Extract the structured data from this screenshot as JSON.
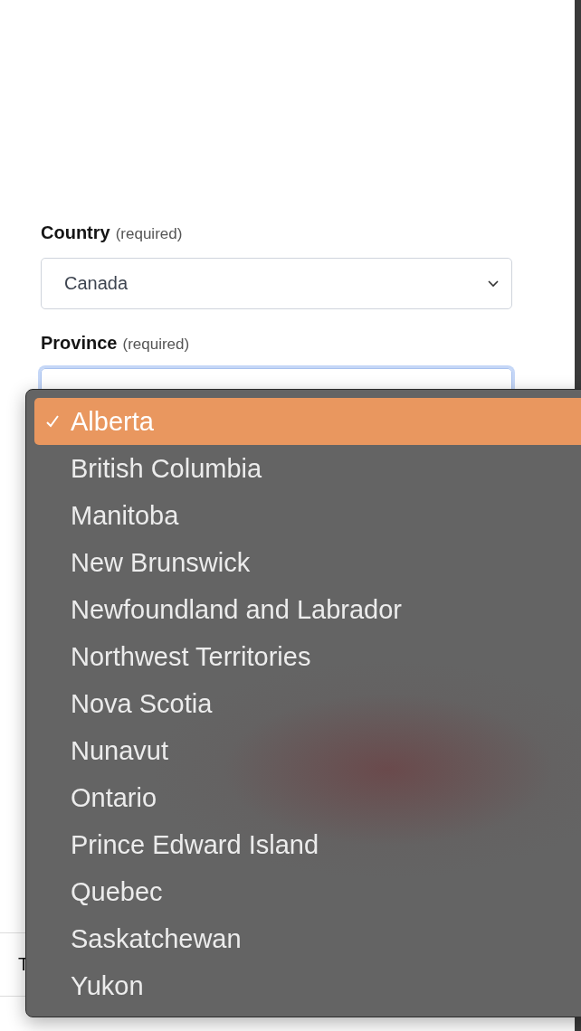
{
  "country": {
    "label": "Country",
    "hint": "(required)",
    "value": "Canada"
  },
  "province": {
    "label": "Province",
    "hint": "(required)",
    "focused": true
  },
  "dropdown": {
    "options": [
      {
        "label": "Alberta",
        "selected": true
      },
      {
        "label": "British Columbia",
        "selected": false
      },
      {
        "label": "Manitoba",
        "selected": false
      },
      {
        "label": "New Brunswick",
        "selected": false
      },
      {
        "label": "Newfoundland and Labrador",
        "selected": false
      },
      {
        "label": "Northwest Territories",
        "selected": false
      },
      {
        "label": "Nova Scotia",
        "selected": false
      },
      {
        "label": "Nunavut",
        "selected": false
      },
      {
        "label": "Ontario",
        "selected": false
      },
      {
        "label": "Prince Edward Island",
        "selected": false
      },
      {
        "label": "Quebec",
        "selected": false
      },
      {
        "label": "Saskatchewan",
        "selected": false
      },
      {
        "label": "Yukon",
        "selected": false
      }
    ]
  },
  "table": {
    "cell": "T"
  }
}
